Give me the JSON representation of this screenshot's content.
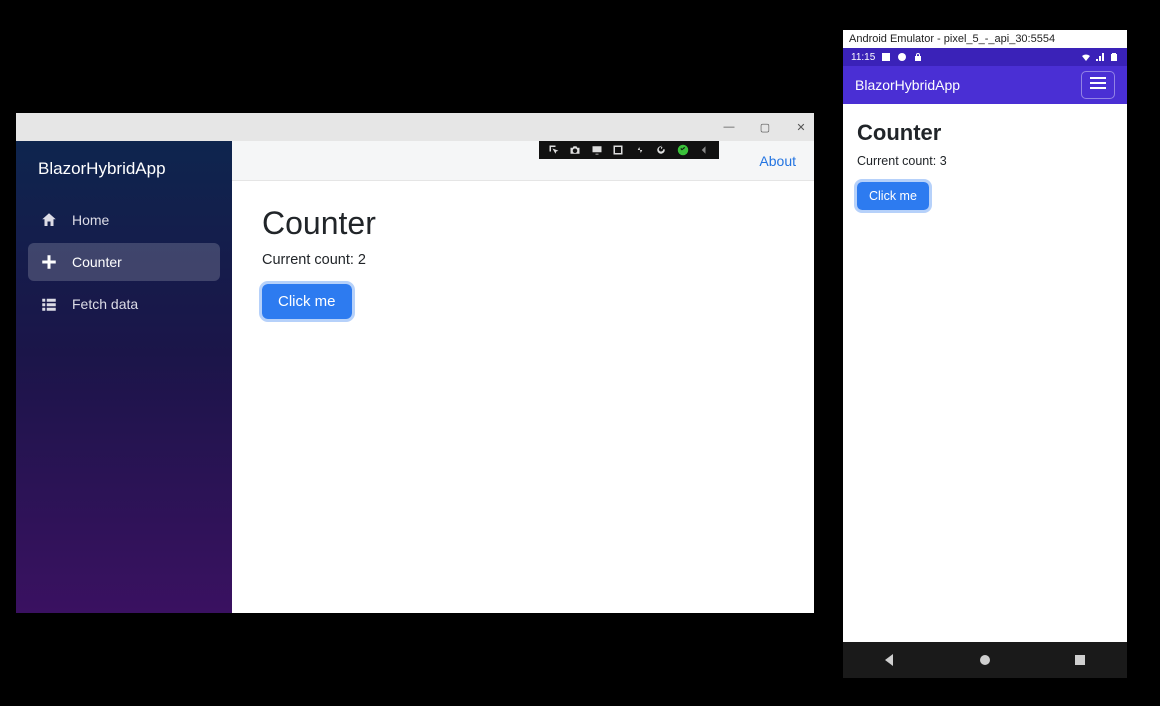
{
  "desktop": {
    "app_name": "BlazorHybridApp",
    "titlebar": {
      "min": "—",
      "max": "▢",
      "close": "✕"
    },
    "nav": {
      "items": [
        {
          "label": "Home",
          "icon": "home-icon",
          "active": false
        },
        {
          "label": "Counter",
          "icon": "plus-icon",
          "active": true
        },
        {
          "label": "Fetch data",
          "icon": "list-icon",
          "active": false
        }
      ]
    },
    "about_label": "About",
    "page": {
      "heading": "Counter",
      "count_prefix": "Current count: ",
      "count_value": "2",
      "button_label": "Click me"
    },
    "debug_icons": [
      "select",
      "camera",
      "screen",
      "inspect",
      "network",
      "refresh",
      "ok",
      "collapse"
    ]
  },
  "emulator": {
    "window_title": "Android Emulator - pixel_5_-_api_30:5554",
    "status_time": "11:15",
    "appbar_title": "BlazorHybridApp",
    "page": {
      "heading": "Counter",
      "count_prefix": "Current count: ",
      "count_value": "3",
      "button_label": "Click me"
    }
  }
}
